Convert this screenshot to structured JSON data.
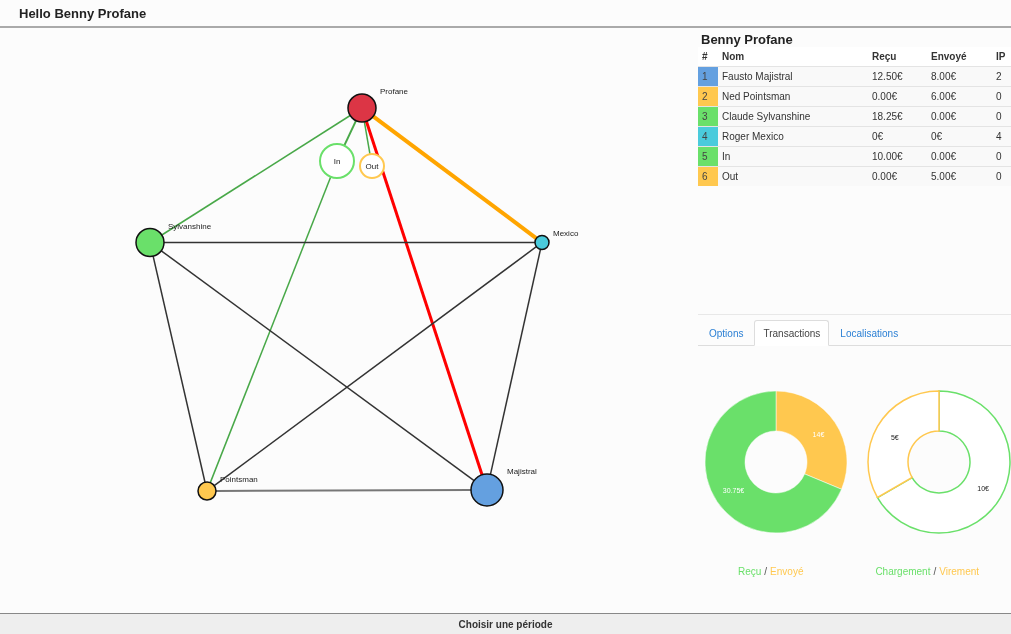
{
  "header": {
    "title": "Hello Benny Profane"
  },
  "graph": {
    "nodes": [
      {
        "label": "Profane",
        "color": "#dc3545",
        "kind": "solid"
      },
      {
        "label": "In",
        "color": "#6ae06a",
        "kind": "ring"
      },
      {
        "label": "Out",
        "color": "#ffc84f",
        "kind": "ring"
      },
      {
        "label": "Sylvanshine",
        "color": "#6ae06a",
        "kind": "solid"
      },
      {
        "label": "Mexico",
        "color": "#4acbdc",
        "kind": "solid"
      },
      {
        "label": "Pointsman",
        "color": "#ffc84f",
        "kind": "solid"
      },
      {
        "label": "Majistral",
        "color": "#64a0e0",
        "kind": "solid"
      }
    ],
    "edges": [
      {
        "color": "#48a848",
        "kind": "thin"
      },
      {
        "color": "#48a848",
        "kind": "double"
      },
      {
        "color": "#48a848",
        "kind": "thin"
      },
      {
        "color": "#48a848",
        "kind": "thin"
      },
      {
        "color": "#ff0000",
        "kind": "thick"
      },
      {
        "color": "#ffa500",
        "kind": "heavy"
      },
      {
        "color": "#333333",
        "kind": "thin"
      },
      {
        "color": "#333333",
        "kind": "thin"
      },
      {
        "color": "#333333",
        "kind": "thin"
      },
      {
        "color": "#333333",
        "kind": "thin"
      },
      {
        "color": "#333333",
        "kind": "thin"
      },
      {
        "color": "#777777",
        "kind": "double"
      }
    ]
  },
  "panel": {
    "title": "Benny Profane",
    "table": {
      "columns": [
        "#",
        "Nom",
        "Reçu",
        "Envoyé",
        "IP"
      ],
      "rows": [
        {
          "num": "1",
          "name": "Fausto Majistral",
          "recu": "12.50€",
          "envoye": "8.00€",
          "ip": "2",
          "color": "#64a0e0"
        },
        {
          "num": "2",
          "name": "Ned Pointsman",
          "recu": "0.00€",
          "envoye": "6.00€",
          "ip": "0",
          "color": "#ffc84f"
        },
        {
          "num": "3",
          "name": "Claude Sylvanshine",
          "recu": "18.25€",
          "envoye": "0.00€",
          "ip": "0",
          "color": "#6ae06a"
        },
        {
          "num": "4",
          "name": "Roger Mexico",
          "recu": "0€",
          "envoye": "0€",
          "ip": "4",
          "color": "#4acbdc"
        },
        {
          "num": "5",
          "name": "In",
          "recu": "10.00€",
          "envoye": "0.00€",
          "ip": "0",
          "color": "#6ae06a"
        },
        {
          "num": "6",
          "name": "Out",
          "recu": "0.00€",
          "envoye": "5.00€",
          "ip": "0",
          "color": "#ffc84f"
        }
      ]
    },
    "tabs": [
      {
        "label": "Options",
        "selected": false
      },
      {
        "label": "Transactions",
        "selected": true
      },
      {
        "label": "Localisations",
        "selected": false
      }
    ],
    "charts": [
      {
        "kind": "filled",
        "chart_data": {
          "type": "donut",
          "values": [
            14,
            30.75
          ],
          "colors": [
            "#ffc84f",
            "#6ae06a"
          ],
          "value_labels": [
            "14€",
            "30.75€"
          ]
        },
        "legend": [
          {
            "label": "Reçu",
            "color": "#6ae06a"
          },
          {
            "label": "Envoyé",
            "color": "#ffc84f"
          }
        ],
        "separator": "/"
      },
      {
        "kind": "outline",
        "chart_data": {
          "type": "donut",
          "values": [
            10,
            5
          ],
          "colors": [
            "#6ae06a",
            "#ffc84f"
          ],
          "value_labels": [
            "10€",
            "5€"
          ]
        },
        "legend": [
          {
            "label": "Chargement",
            "color": "#6ae06a"
          },
          {
            "label": "Virement",
            "color": "#ffc84f"
          }
        ],
        "separator": "/"
      }
    ]
  },
  "footer": {
    "button": "Choisir une période"
  }
}
